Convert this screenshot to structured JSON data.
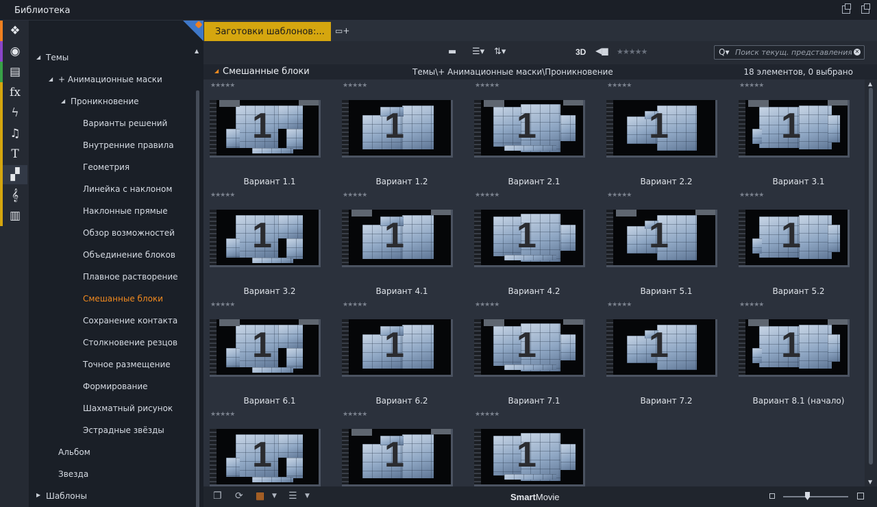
{
  "window": {
    "title": "Библиотека"
  },
  "sidebar_icons": [
    {
      "name": "media-icon",
      "glyph": "❖",
      "stripe": "#f08020"
    },
    {
      "name": "film-reel-icon",
      "glyph": "◉",
      "stripe": "#8a45c8"
    },
    {
      "name": "projects-icon",
      "glyph": "▤",
      "stripe": "#38a148"
    },
    {
      "name": "fx-icon",
      "glyph": "fx",
      "stripe": "#d5a60f"
    },
    {
      "name": "lightning-icon",
      "glyph": "ϟ",
      "stripe": "#d5a60f"
    },
    {
      "name": "music-icon",
      "glyph": "♫",
      "stripe": "#d5a60f"
    },
    {
      "name": "title-icon",
      "glyph": "T",
      "stripe": "#d5a60f"
    },
    {
      "name": "montage-icon",
      "glyph": "▞",
      "stripe": "#d5a60f"
    },
    {
      "name": "scorefitter-icon",
      "glyph": "𝄞",
      "stripe": "#d5a60f"
    },
    {
      "name": "piano-icon",
      "glyph": "▥",
      "stripe": "#d5a60f"
    }
  ],
  "tree": {
    "themes": "Темы",
    "anim_masks": "+ Анимационные маски",
    "penetration": "Проникновение",
    "children": [
      "Варианты решений",
      "Внутренние правила",
      "Геометрия",
      "Линейка с наклоном",
      "Наклонные прямые",
      "Обзор возможностей",
      "Объединение блоков",
      "Плавное растворение",
      "Смешанные блоки",
      "Сохранение контакта",
      "Столкновение резцов",
      "Точное размещение",
      "Формирование",
      "Шахматный рисунок",
      "Эстрадные звёзды"
    ],
    "album": "Альбом",
    "star": "Звезда",
    "templates": "Шаблоны"
  },
  "tab": {
    "label": "Заготовки шаблонов:..."
  },
  "toolbar": {
    "three_d": "3D",
    "rating": "★★★★★",
    "search_placeholder": "Поиск текущ. представления"
  },
  "header": {
    "title": "Смешанные блоки",
    "path": "Темы\\+ Анимационные маски\\Проникновение",
    "count": "18 элементов, 0 выбрано"
  },
  "items": [
    {
      "label": "Вариант 1.1"
    },
    {
      "label": "Вариант 1.2"
    },
    {
      "label": "Вариант 2.1"
    },
    {
      "label": "Вариант 2.2"
    },
    {
      "label": "Вариант 3.1"
    },
    {
      "label": "Вариант 3.2"
    },
    {
      "label": "Вариант 4.1"
    },
    {
      "label": "Вариант 4.2"
    },
    {
      "label": "Вариант 5.1"
    },
    {
      "label": "Вариант 5.2"
    },
    {
      "label": "Вариант 6.1"
    },
    {
      "label": "Вариант 6.2"
    },
    {
      "label": "Вариант 7.1"
    },
    {
      "label": "Вариант 7.2"
    },
    {
      "label": "Вариант 8.1 (начало)"
    },
    {
      "label": ""
    },
    {
      "label": ""
    },
    {
      "label": ""
    }
  ],
  "item_rating": "★★★★★",
  "thumb_digit": "1",
  "bottom": {
    "brand_bold": "Smart",
    "brand_rest": "Movie"
  }
}
